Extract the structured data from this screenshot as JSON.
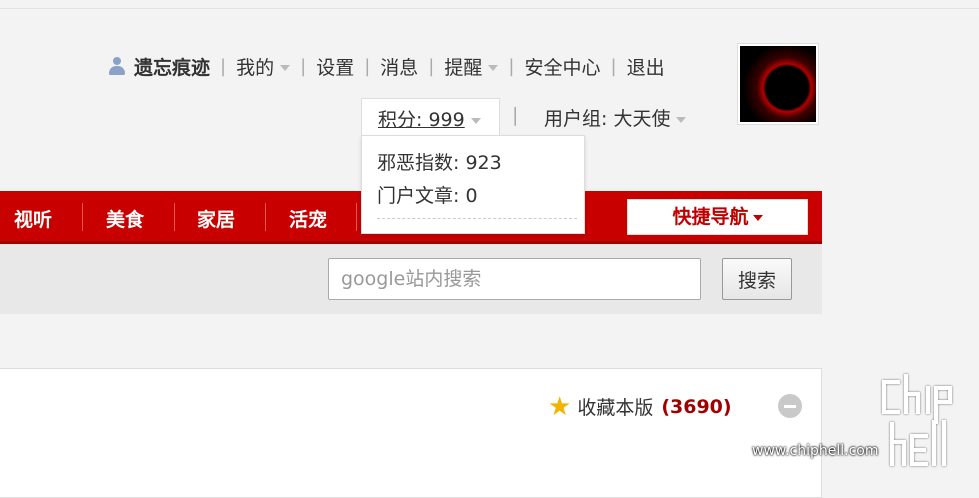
{
  "userbar": {
    "username": "遗忘痕迹",
    "items": [
      "我的",
      "设置",
      "消息",
      "提醒",
      "安全中心",
      "退出"
    ]
  },
  "points": {
    "label": "积分: 999",
    "usergroup": "用户组: 大天使",
    "dropdown": [
      "邪恶指数: 923",
      "门户文章: 0"
    ]
  },
  "nav": {
    "items": [
      "视听",
      "美食",
      "家居",
      "活宠"
    ],
    "quick_nav": "快捷导航"
  },
  "search": {
    "placeholder": "google站内搜索",
    "button": "搜索"
  },
  "favorite": {
    "label": "收藏本版",
    "count": "(3690)"
  },
  "watermark": {
    "url": "www.chiphell.com",
    "logo": "chip hell"
  },
  "colors": {
    "nav_red": "#c90000",
    "count_red": "#a00000",
    "star": "#f3b400"
  }
}
